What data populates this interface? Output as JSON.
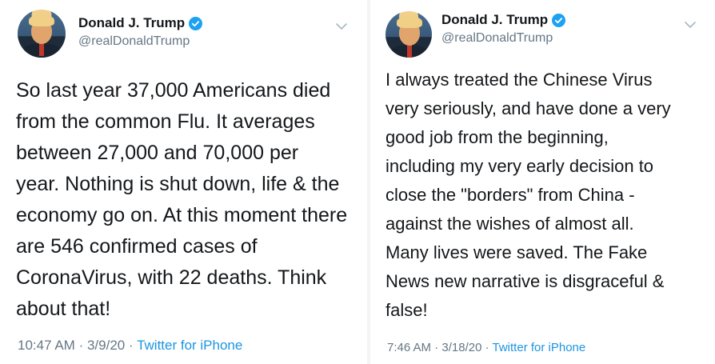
{
  "tweets": [
    {
      "author": {
        "name": "Donald J. Trump",
        "handle": "@realDonaldTrump"
      },
      "text": "So last year 37,000 Americans died\nfrom the common Flu. It averages\nbetween 27,000 and 70,000 per\nyear. Nothing is shut down, life & the\neconomy go on. At this moment there\nare 546 confirmed cases of\nCoronaVirus, with 22 deaths. Think\nabout that!",
      "time": "10:47 AM",
      "date": "3/9/20",
      "source": "Twitter for iPhone"
    },
    {
      "author": {
        "name": "Donald J. Trump",
        "handle": "@realDonaldTrump"
      },
      "text": "I always treated the Chinese Virus\nvery seriously, and have done a very\ngood job from the beginning,\nincluding my very early decision to\nclose the \"borders\" from China -\nagainst the wishes of almost all.\nMany lives were saved. The Fake\nNews new narrative is disgraceful &\nfalse!",
      "time": "7:46 AM",
      "date": "3/18/20",
      "source": "Twitter for iPhone"
    }
  ],
  "separator": "·",
  "colors": {
    "verified": "#1da1f2",
    "link": "#1b95e0",
    "muted": "#657786"
  },
  "icons": {
    "verified": "verified-badge-icon",
    "menu": "chevron-down-icon"
  }
}
